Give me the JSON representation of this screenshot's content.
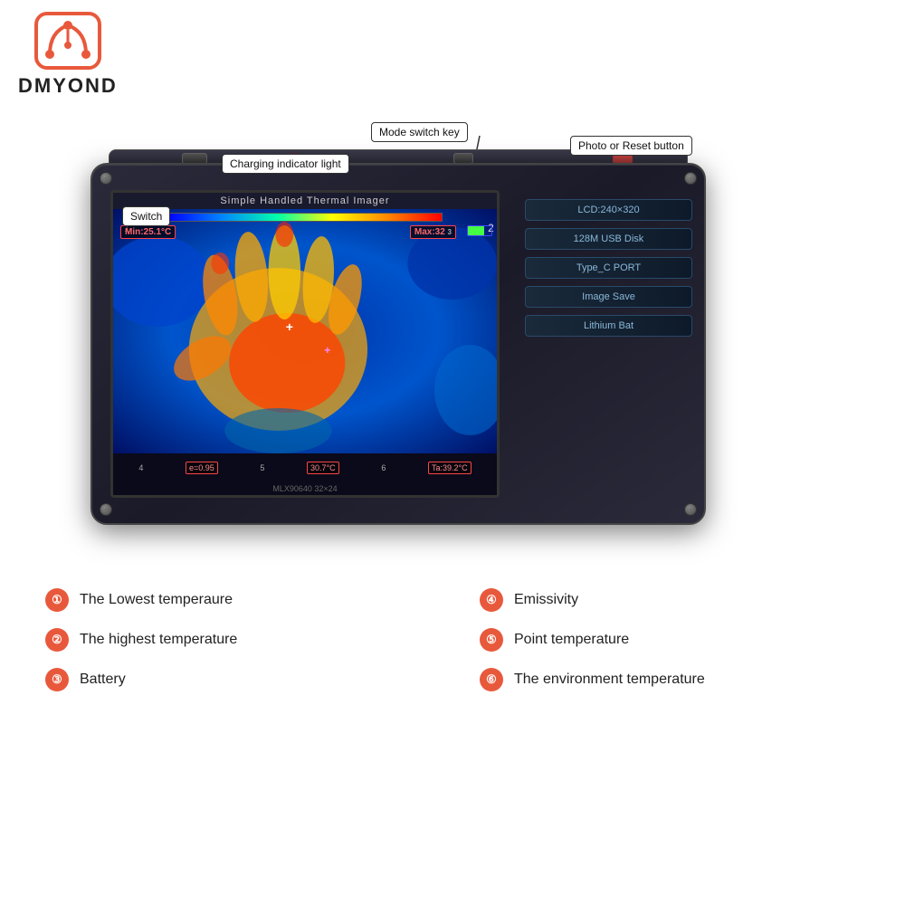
{
  "brand": {
    "name": "DMYOND"
  },
  "callouts": {
    "switch": "Switch",
    "charging": "Charging indicator light",
    "mode_switch": "Mode switch key",
    "photo_reset": "Photo or Reset button"
  },
  "device": {
    "screen_title": "Simple Handled Thermal Imager",
    "temp_min": "Min:25.1°C",
    "temp_max": "Max:32",
    "model_info": "MLX90640  32×24",
    "specs": [
      "LCD:240×320",
      "128M USB Disk",
      "Type_C PORT",
      "Image Save",
      "Lithium Bat"
    ],
    "bottom_stats": {
      "label1": "4",
      "stat1": "e=0.95",
      "label2": "5",
      "stat2": "30.7°C",
      "label3": "6",
      "stat3": "Ta:39.2°C"
    }
  },
  "features": [
    {
      "number": "1",
      "text": "The Lowest temperaure"
    },
    {
      "number": "2",
      "text": "The highest temperature"
    },
    {
      "number": "3",
      "text": "Battery"
    },
    {
      "number": "4",
      "text": "Emissivity"
    },
    {
      "number": "5",
      "text": "Point temperature"
    },
    {
      "number": "6",
      "text": "The environment temperature"
    }
  ]
}
